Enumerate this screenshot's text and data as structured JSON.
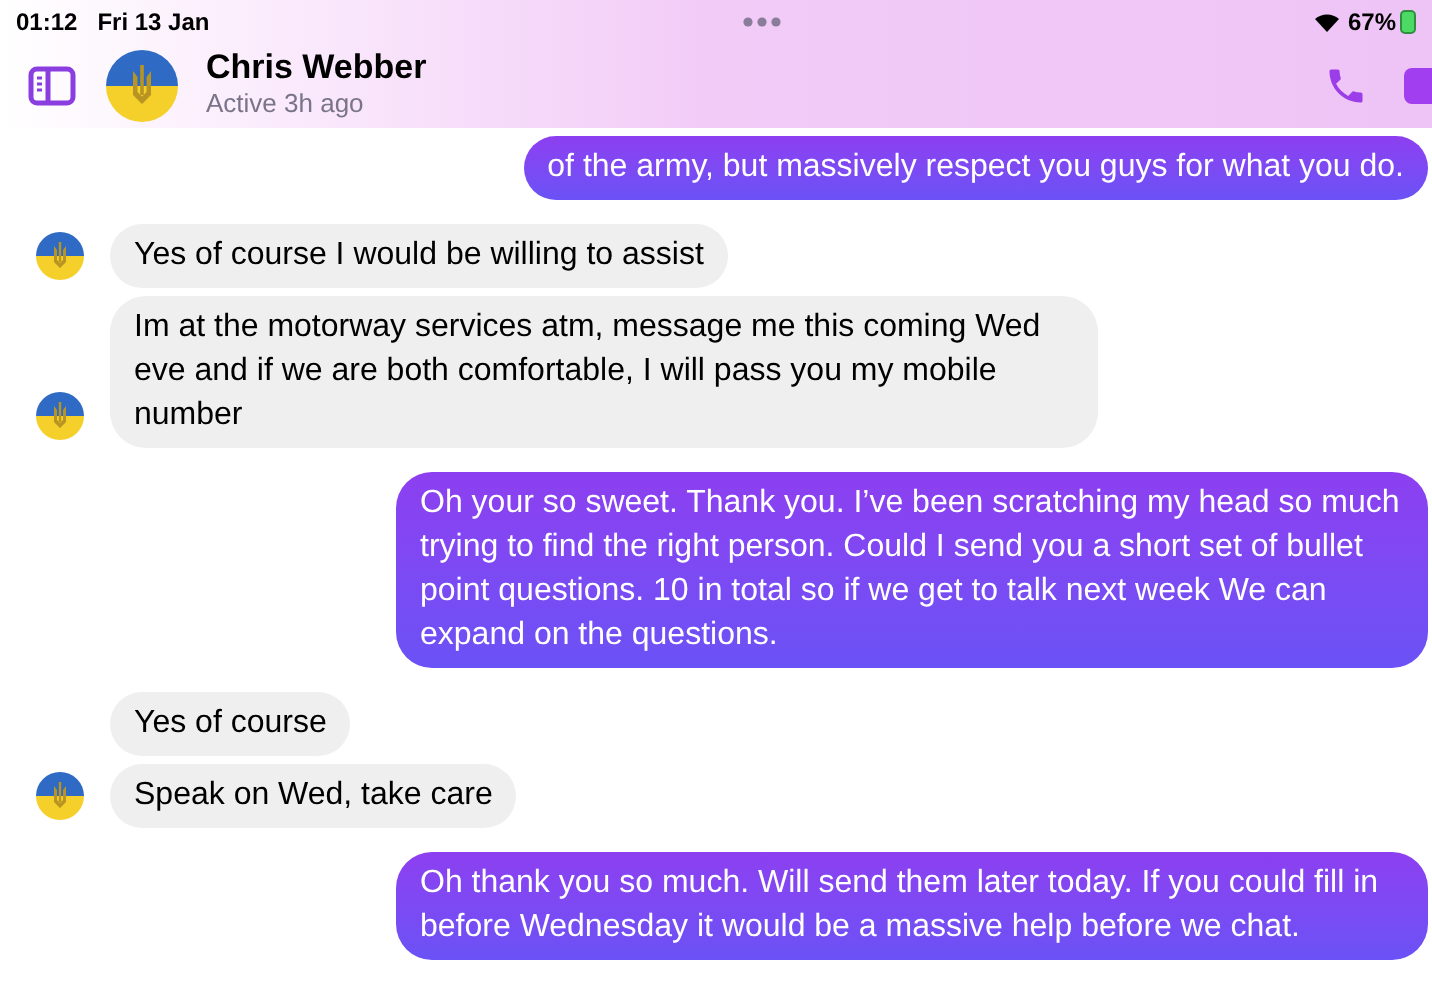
{
  "status_bar": {
    "time": "01:12",
    "date": "Fri 13 Jan",
    "battery": "67%"
  },
  "header": {
    "name": "Chris Webber",
    "status": "Active 3h ago"
  },
  "messages": [
    {
      "kind": "outgoing",
      "text": "of the army, but massively respect you guys for what you do."
    },
    {
      "kind": "incoming",
      "text": "Yes of course I would be willing to assist",
      "avatar": true
    },
    {
      "kind": "incoming",
      "text": "Im at the motorway services atm, message me this coming Wed eve and if we are both comfortable, I will pass you my mobile number",
      "avatar": true
    },
    {
      "kind": "outgoing",
      "text": "Oh your so sweet. Thank you. I’ve been scratching my head so much trying to find the right person. Could I send you a short set of bullet point questions. 10 in total so if we get to talk next week We can expand on the questions."
    },
    {
      "kind": "incoming",
      "text": "Yes of course",
      "avatar": false
    },
    {
      "kind": "incoming",
      "text": "Speak on Wed, take care",
      "avatar": true
    },
    {
      "kind": "outgoing",
      "text": "Oh thank you so much. Will send them later today. If you could fill in before Wednesday it would be a massive help before we chat."
    }
  ]
}
